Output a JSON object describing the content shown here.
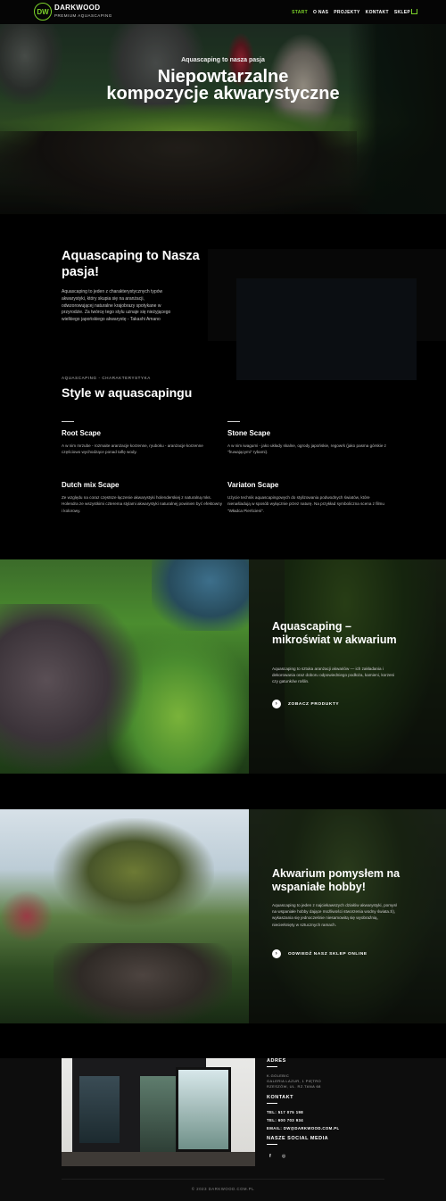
{
  "nav": {
    "logo": "DW",
    "brand": "DARKWOOD",
    "tagline": "PREMIUM AQUASCAPING",
    "items": [
      "START",
      "O NAS",
      "PROJEKTY",
      "KONTAKT",
      "SKLEP"
    ],
    "accent": "#7bd12a"
  },
  "hero": {
    "kicker": "Aquascaping to nasza pasja",
    "title_line1": "Niepowtarzalne",
    "title_line2": "kompozycje akwarystyczne"
  },
  "intro": {
    "title": "Aquascaping to Nasza pasja!",
    "text": "Aquascaping to jeden z charakterystycznych typów akwarystyki, który skupia się na aranżacji, odwzorowującej naturalne krajobrazy spotykane w przyrodzie. Za twórcę tego stylu uznaje się nieżyjącego wielkiego japońskiego akwarystę - Takashi Amano"
  },
  "styles": {
    "kicker": "AQUASCAPING - CHARAKTERYSTYKA",
    "title": "Style w aquascapingu",
    "items": [
      {
        "name": "Root Scape",
        "desc": "A w nim mrzube - rozmaite aranżacje korzenne, ryuboku - aranżacje korzenne częściowo wychodzące ponad taflę wody."
      },
      {
        "name": "Stone Scape",
        "desc": "A w nim iwagumi - jako układy skalne, ogrody japońskie, regowrk (jako pasma górskie z \"fruwającymi\" rybami)."
      },
      {
        "name": "Dutch mix Scape",
        "desc": "Ze względu na coraz częstsze łączenie akwarystyki holenderskiej z naturalną mks. Holendra ze wszystkimi czterema stylami akwarystyki naturalnej powinien być efektowny i kolorowy."
      },
      {
        "name": "Variaton Scape",
        "desc": "Użycie technik aquascapingowych do stylizowania podwodnych światów, które nienaśladują w sposób wyłącznie przez naturę. Na przykład symboliczna scena z filmu \"Władca Pierścieni\"."
      }
    ]
  },
  "feature1": {
    "title": "Aquascaping – mikroświat w akwarium",
    "text": "Aquascaping to sztuka aranżacji akwariów — ich zakładania i dekorowania oraz doboru odpowiedniego podłoża, kamieni, korzeni czy gatunków roślin.",
    "cta": "ZOBACZ PRODUKTY"
  },
  "feature2": {
    "title": "Akwarium pomysłem na wspaniałe hobby!",
    "text": "Aquascaping to jeden z najciekawszych działów akwarystyki, pomysł na wspaniałe hobby dające możliwości stworzenia wodny świata.Ś), wykaszania się jednocześnie niesamowitą się wyobraźnią, niecierknięty w sztucznych ramach.",
    "cta": "ODWIEDŹ NASZ SKLEP ONLINE"
  },
  "footer": {
    "address_head": "ADRES",
    "address_lines": [
      "K.GOLEBIC",
      "GALERIA LAZUR, 1 PIĘTRO",
      "RZESZÓW, UL. RZ.TANA 68"
    ],
    "contact_head": "KONTAKT",
    "tel1_label": "TEL:",
    "tel1": "517 075 198",
    "tel2_label": "TEL:",
    "tel2": "600 703 934",
    "email_label": "EMAIL:",
    "email": "DW@DARKWOOD.COM.PL",
    "social_head": "NASZE SOCIAL MEDIA",
    "social_icons": [
      "f",
      "◎"
    ],
    "copyright": "© 2023 DARKWOOD.COM.PL"
  }
}
